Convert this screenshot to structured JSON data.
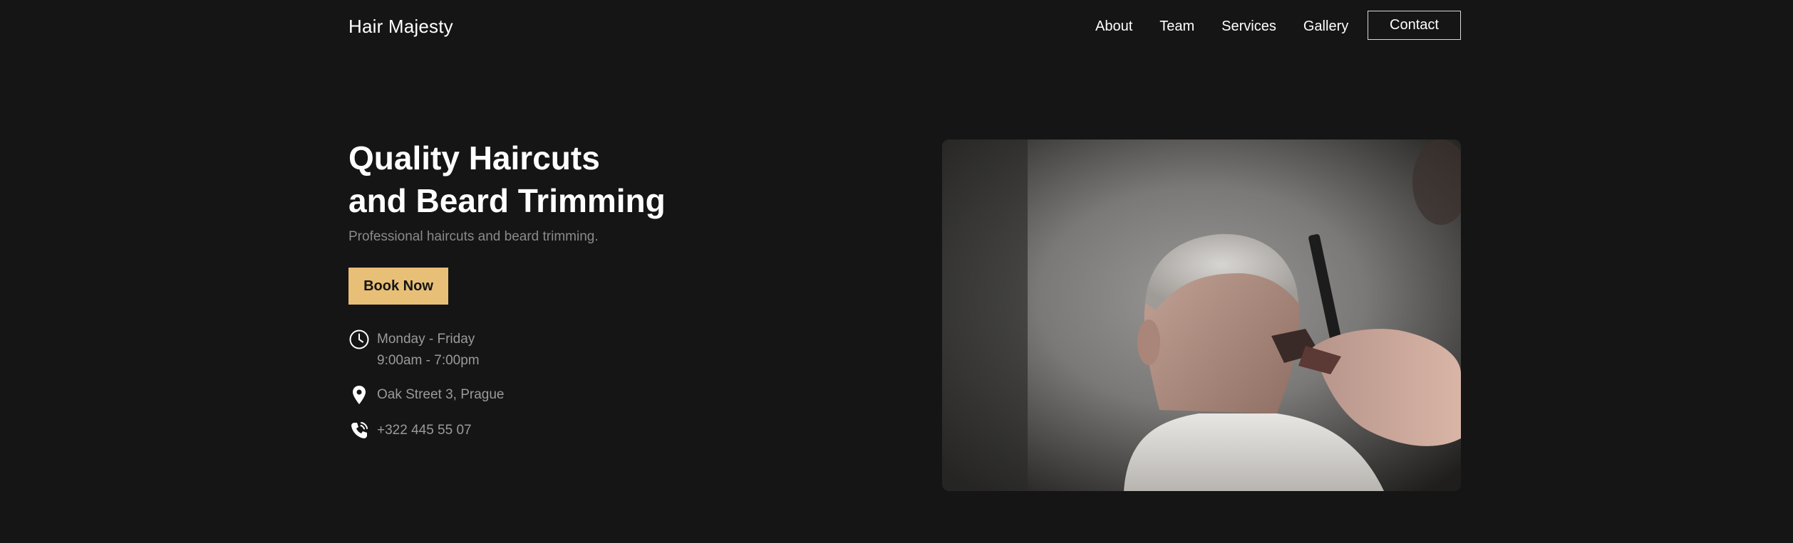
{
  "brand": "Hair Majesty",
  "nav": {
    "links": [
      "About",
      "Team",
      "Services",
      "Gallery"
    ],
    "contact": "Contact"
  },
  "hero": {
    "title_line1": "Quality Haircuts",
    "title_line2": "and Beard Trimming",
    "subtitle": "Professional haircuts and beard trimming.",
    "cta": "Book Now",
    "hours_days": "Monday - Friday",
    "hours_time": "9:00am - 7:00pm",
    "address": "Oak Street 3, Prague",
    "phone": "+322 445 55 07",
    "image_icon": "barber-photo",
    "icons": [
      "clock-icon",
      "location-pin-icon",
      "phone-icon"
    ]
  },
  "colors": {
    "background": "#151515",
    "accent": "#e8bf76",
    "muted_text": "#9a9a9a"
  }
}
